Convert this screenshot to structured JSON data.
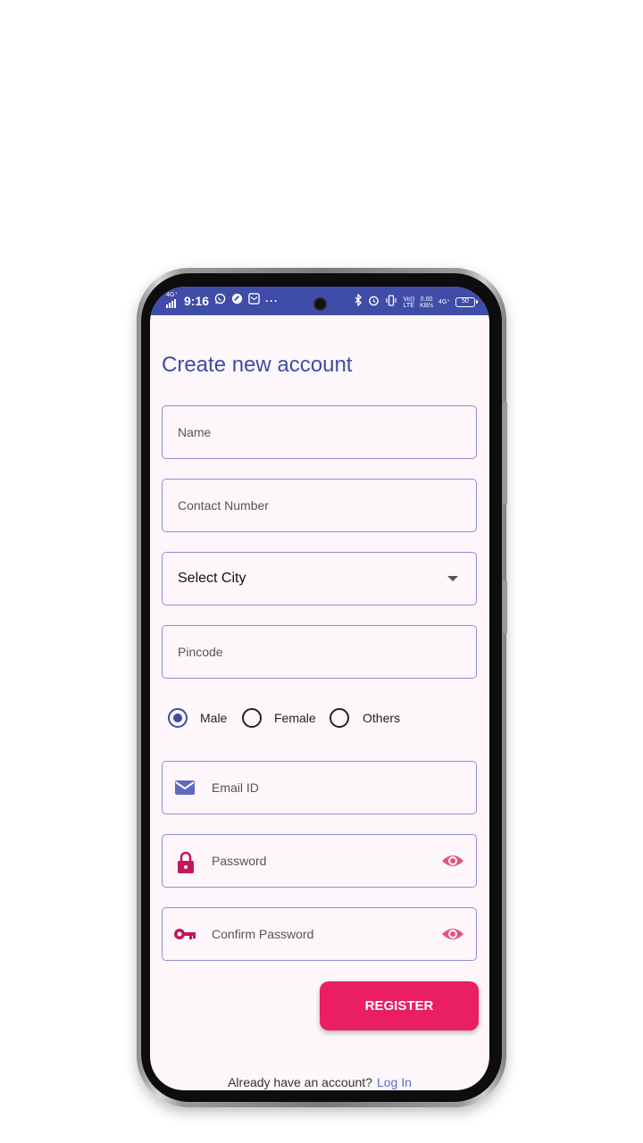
{
  "status_bar": {
    "time": "9:16",
    "network_tag": "4G⁺",
    "lte_top": "Vo))",
    "lte_bottom": "LTE",
    "speed_top": "0.00",
    "speed_bottom": "KB/s",
    "net2": "4G⁺",
    "battery": "50",
    "more": "···"
  },
  "page": {
    "title": "Create new account"
  },
  "form": {
    "name_placeholder": "Name",
    "contact_placeholder": "Contact Number",
    "city_select_value": "Select City",
    "pincode_placeholder": "Pincode",
    "gender_options": [
      "Male",
      "Female",
      "Others"
    ],
    "gender_selected": "Male",
    "email_placeholder": "Email ID",
    "password_placeholder": "Password",
    "confirm_password_placeholder": "Confirm Password",
    "register_label": "REGISTER"
  },
  "footer": {
    "prompt": "Already have an account?",
    "login_link": "Log In"
  },
  "colors": {
    "primary": "#3f4ca8",
    "accent": "#e91e63",
    "icon_pink": "#c2185b",
    "eye_pink": "#e0557a",
    "email_icon": "#5c6bc0"
  },
  "icons": [
    "email-icon",
    "lock-icon",
    "key-icon",
    "eye-icon",
    "dropdown-arrow-icon"
  ]
}
